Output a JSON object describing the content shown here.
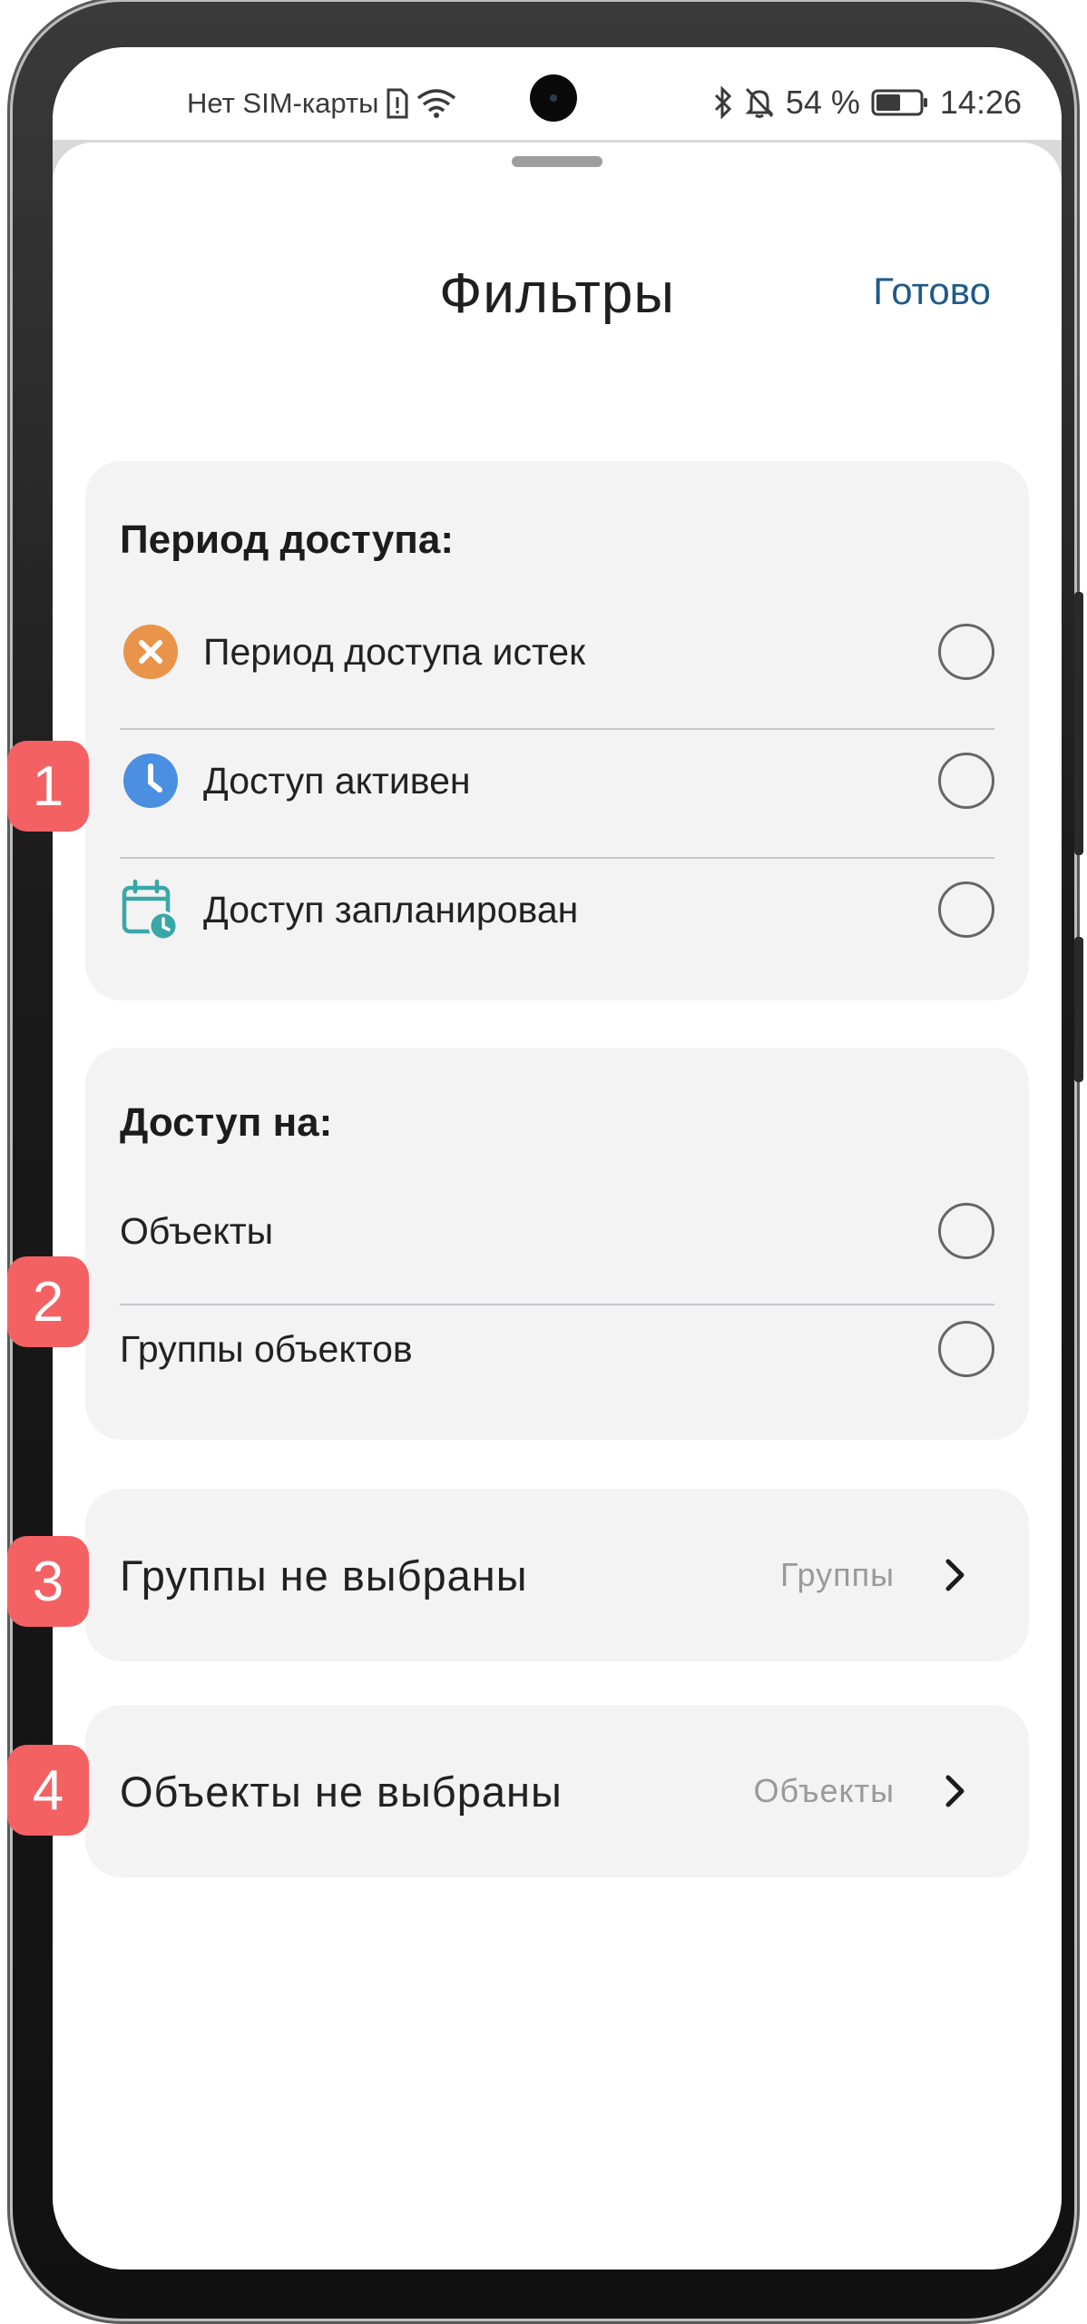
{
  "status_bar": {
    "sim_text": "Нет SIM-карты",
    "battery_percent": "54 %",
    "time": "14:26"
  },
  "header": {
    "title": "Фильтры",
    "done_label": "Готово"
  },
  "access_period": {
    "heading": "Период доступа:",
    "options": [
      {
        "label": "Период доступа истек",
        "icon": "expired-x-icon",
        "icon_color": "#e8944a",
        "selected": false
      },
      {
        "label": "Доступ активен",
        "icon": "clock-icon",
        "icon_color": "#4a8fe0",
        "selected": false
      },
      {
        "label": "Доступ запланирован",
        "icon": "calendar-clock-icon",
        "icon_color": "#3aa7a7",
        "selected": false
      }
    ]
  },
  "access_to": {
    "heading": "Доступ на:",
    "options": [
      {
        "label": "Объекты",
        "selected": false
      },
      {
        "label": "Группы объектов",
        "selected": false
      }
    ]
  },
  "groups_selector": {
    "label": "Группы не выбраны",
    "value": "Группы"
  },
  "objects_selector": {
    "label": "Объекты не выбраны",
    "value": "Объекты"
  },
  "badges": [
    "1",
    "2",
    "3",
    "4"
  ],
  "colors": {
    "accent": "#1f5b8a",
    "badge": "#f46163",
    "card_bg": "#f3f3f4"
  }
}
